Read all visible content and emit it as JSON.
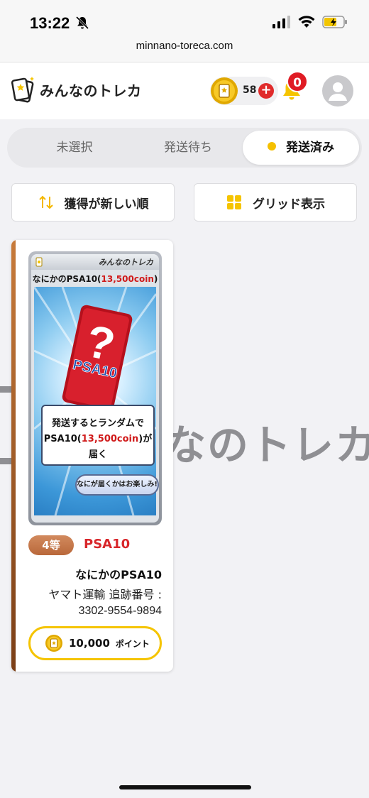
{
  "status_bar": {
    "time": "13:22"
  },
  "browser": {
    "url": "minnano-toreca.com"
  },
  "header": {
    "logo_text": "みんなのトレカ",
    "coin_count": "58",
    "notification_count": "0"
  },
  "tabs": [
    {
      "label": "未選択",
      "selected": false
    },
    {
      "label": "発送待ち",
      "selected": false
    },
    {
      "label": "発送済み",
      "selected": true
    }
  ],
  "toolbar": {
    "sort_label": "獲得が新しい順",
    "grid_label": "グリッド表示"
  },
  "background_watermark": "なのトレカ",
  "prize": {
    "art": {
      "top_logo": "みんなのトレカ",
      "title_prefix": "なにかのPSA10(",
      "title_coin": "13,500coin",
      "title_suffix": ")",
      "card_mark": "PSA10",
      "card_question": "?",
      "message_line1": "発送するとランダムで",
      "message_line2_prefix": "PSA10(",
      "message_line2_coin": "13,500coin",
      "message_line2_suffix": ")が届く",
      "pill_text": "なにが届くかはお楽しみ!"
    },
    "rank_badge": "4等",
    "rank_label": "PSA10",
    "name": "なにかのPSA10",
    "shipping_carrier": "ヤマト運輸 追跡番号 :",
    "tracking_number": "3302-9554-9894",
    "points_value": "10,000",
    "points_unit": "ポイント"
  },
  "colors": {
    "accent_yellow": "#f5c400",
    "danger_red": "#e01b24",
    "rank_bronze": "#c77a3a"
  }
}
